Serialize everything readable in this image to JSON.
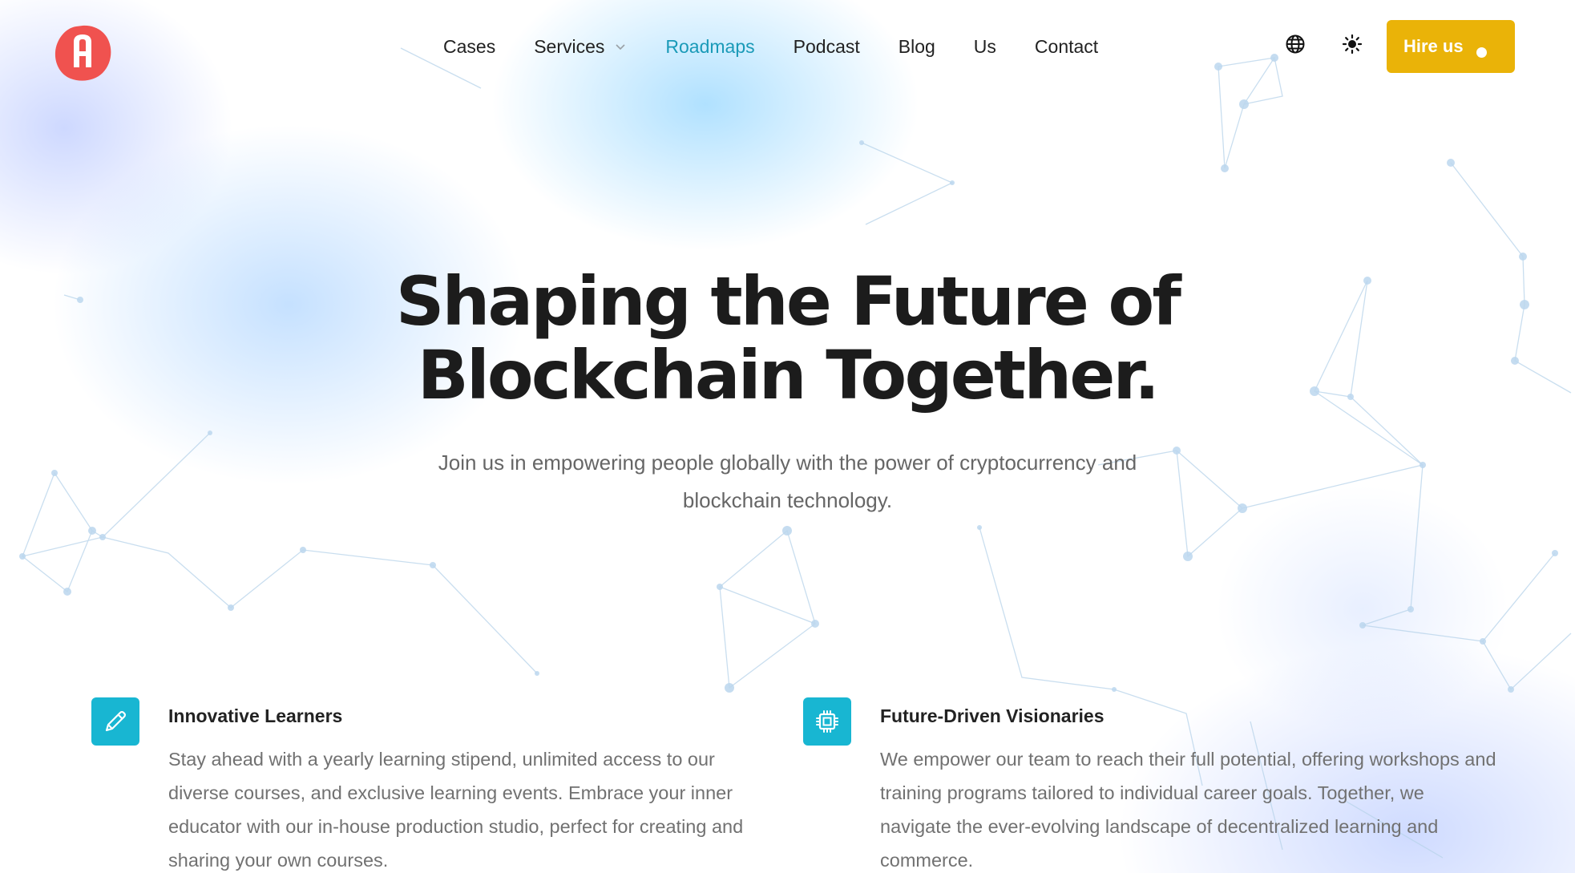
{
  "brand": {
    "logo_icon": "a-letter-logo-icon",
    "accent": "#f0524f"
  },
  "nav": {
    "items": [
      {
        "label": "Cases",
        "active": false
      },
      {
        "label": "Services",
        "active": false,
        "has_dropdown": true
      },
      {
        "label": "Roadmaps",
        "active": true
      },
      {
        "label": "Podcast",
        "active": false
      },
      {
        "label": "Blog",
        "active": false
      },
      {
        "label": "Us",
        "active": false
      },
      {
        "label": "Contact",
        "active": false
      }
    ],
    "active_color": "#1a9ab8",
    "language_icon": "globe-icon",
    "theme_icon": "sun-icon",
    "cta": {
      "label": "Hire us",
      "color": "#eab308"
    }
  },
  "hero": {
    "title_line1": "Shaping the Future of",
    "title_line2": "Blockchain Together.",
    "subtitle": "Join us in empowering people globally with the power of cryptocurrency and blockchain technology."
  },
  "features": [
    {
      "icon": "pencil-icon",
      "title": "Innovative Learners",
      "text": "Stay ahead with a yearly learning stipend, unlimited access to our diverse courses, and exclusive learning events. Embrace your inner educator with our in-house production studio, perfect for creating and sharing your own courses."
    },
    {
      "icon": "cpu-chip-icon",
      "title": "Future-Driven Visionaries",
      "text": "We empower our team to reach their full potential, offering workshops and training programs tailored to individual career goals. Together, we navigate the ever-evolving landscape of decentralized learning and commerce."
    }
  ],
  "colors": {
    "icon_tile": "#18b6d2"
  }
}
